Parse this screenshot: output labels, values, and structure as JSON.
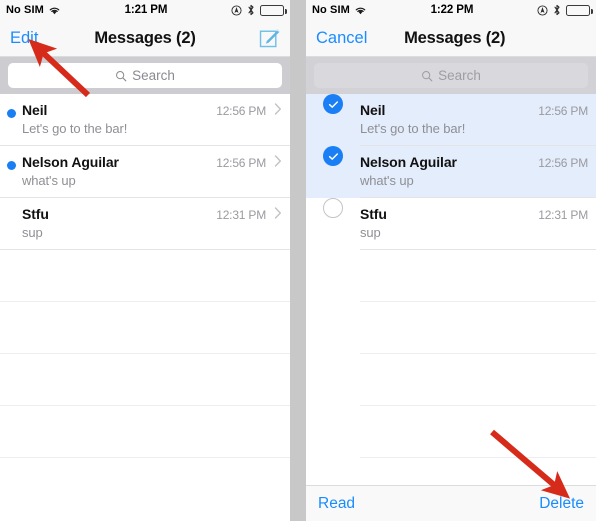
{
  "accent_blue": "#1a8cff",
  "selection_blue": "#1a7ef5",
  "selected_row_bg": "#e4edfb",
  "arrow_red": "#d62b1a",
  "panels": {
    "left": {
      "status": {
        "carrier": "No SIM",
        "wifi_icon": "wifi-icon",
        "time": "1:21 PM",
        "location_icon": "location-icon",
        "bluetooth_icon": "bluetooth-icon",
        "battery_icon": "battery-icon"
      },
      "nav": {
        "left_button": "Edit",
        "title": "Messages (2)",
        "right_icon": "compose-icon"
      },
      "search": {
        "placeholder": "Search",
        "icon": "search-icon"
      },
      "rows": [
        {
          "name": "Neil",
          "preview": "Let's go to the bar!",
          "time": "12:56 PM",
          "unread": true
        },
        {
          "name": "Nelson Aguilar",
          "preview": "what's up",
          "time": "12:56 PM",
          "unread": true
        },
        {
          "name": "Stfu",
          "preview": "sup",
          "time": "12:31 PM",
          "unread": false
        }
      ],
      "annotation": "arrow-pointing-to-edit-button"
    },
    "right": {
      "status": {
        "carrier": "No SIM",
        "wifi_icon": "wifi-icon",
        "time": "1:22 PM",
        "location_icon": "location-icon",
        "bluetooth_icon": "bluetooth-icon",
        "battery_icon": "battery-icon"
      },
      "nav": {
        "left_button": "Cancel",
        "title": "Messages (2)"
      },
      "search": {
        "placeholder": "Search",
        "icon": "search-icon"
      },
      "rows": [
        {
          "name": "Neil",
          "preview": "Let's go to the bar!",
          "time": "12:56 PM",
          "checked": true
        },
        {
          "name": "Nelson Aguilar",
          "preview": "what's up",
          "time": "12:56 PM",
          "checked": true
        },
        {
          "name": "Stfu",
          "preview": "sup",
          "time": "12:31 PM",
          "checked": false
        }
      ],
      "toolbar": {
        "read_label": "Read",
        "delete_label": "Delete"
      },
      "annotation": "arrow-pointing-to-delete-button"
    }
  }
}
